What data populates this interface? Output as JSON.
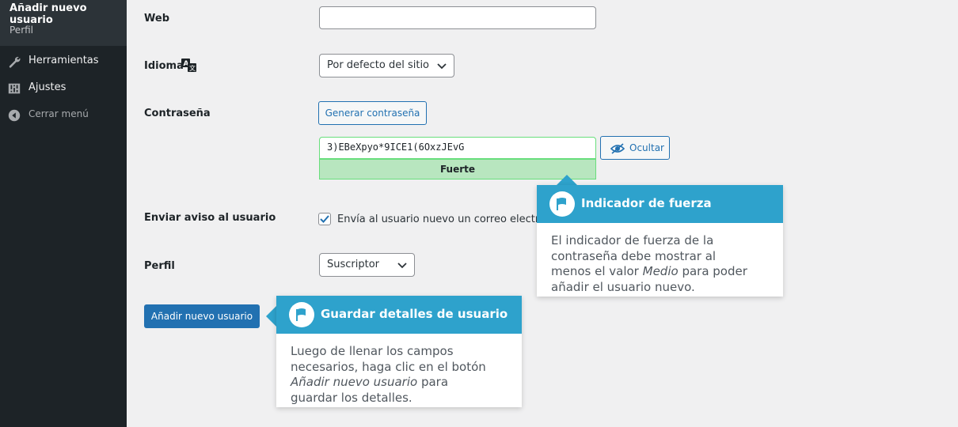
{
  "sidebar": {
    "current_title": "Añadir nuevo usuario",
    "current_sub": "Perfil",
    "items": [
      {
        "label": "Herramientas",
        "icon": "wrench-icon"
      },
      {
        "label": "Ajustes",
        "icon": "sliders-icon"
      },
      {
        "label": "Cerrar menú",
        "icon": "collapse-icon"
      }
    ]
  },
  "form": {
    "web_label": "Web",
    "web_value": "",
    "language_label": "Idioma",
    "language_value": "Por defecto del sitio",
    "password_label": "Contraseña",
    "generate_button": "Generar contraseña",
    "password_value": "3)EBeXpyo*9ICE1(6OxzJEvG",
    "hide_button": "Ocultar",
    "strength_text": "Fuerte",
    "notify_label": "Enviar aviso al usuario",
    "notify_text": "Envía al usuario nuevo un correo electrónico",
    "notify_checked": true,
    "role_label": "Perfil",
    "role_value": "Suscriptor",
    "submit_button": "Añadir nuevo usuario"
  },
  "tooltips": {
    "strength": {
      "title": "Indicador de fuerza",
      "body_1": "El indicador de fuerza de la",
      "body_2": "contraseña debe mostrar al",
      "body_3a": "menos el valor ",
      "body_3b": "Medio",
      "body_3c": " para poder",
      "body_4": "añadir el usuario nuevo."
    },
    "save": {
      "title": "Guardar detalles de usuario",
      "body_1": "Luego de llenar los campos",
      "body_2": "necesarios, haga clic en el botón",
      "body_3a": "Añadir nuevo usuario",
      "body_3b": " para",
      "body_4": "guardar los detalles."
    }
  },
  "colors": {
    "sidebar_bg": "#1d2327",
    "accent": "#2271b1",
    "tooltip_header": "#2ea2cc",
    "strength_bg": "#b8e6bf"
  }
}
